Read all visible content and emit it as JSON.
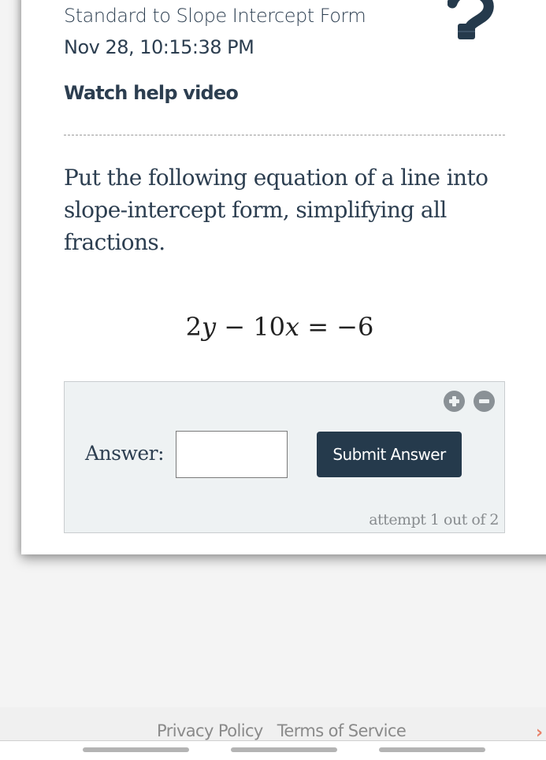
{
  "header": {
    "skill_title": "Standard to Slope Intercept Form",
    "timestamp": "Nov 28, 10:15:38 PM",
    "help_link": "Watch help video",
    "help_icon": "question-mark-icon"
  },
  "question": {
    "prompt": "Put the following equation of a line into slope-intercept form, simplifying all fractions.",
    "equation": {
      "coef_y": "2",
      "var_y": "y",
      "op1": "−",
      "coef_x": "10",
      "var_x": "x",
      "eq": "=",
      "rhs": "−6"
    }
  },
  "answer_panel": {
    "zoom_in_icon": "plus-circle-icon",
    "zoom_out_icon": "minus-circle-icon",
    "label": "Answer:",
    "input_value": "",
    "submit_label": "Submit Answer",
    "attempt_text": "attempt 1 out of 2"
  },
  "footer": {
    "links": [
      "Privacy Policy",
      "Terms of Service"
    ],
    "next_icon": "chevron-right-icon"
  },
  "colors": {
    "primary_text": "#2c3e50",
    "submit_bg": "#253a4c",
    "panel_bg": "#eef2f3",
    "muted_text": "#888c8f",
    "accent_arrow": "#e8826a"
  }
}
